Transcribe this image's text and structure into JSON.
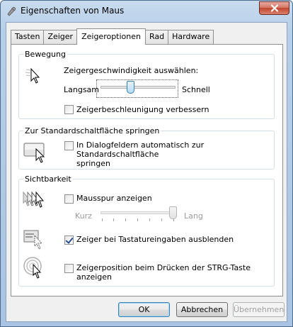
{
  "window": {
    "title": "Eigenschaften von Maus"
  },
  "tabs": [
    {
      "label": "Tasten"
    },
    {
      "label": "Zeiger"
    },
    {
      "label": "Zeigeroptionen"
    },
    {
      "label": "Rad"
    },
    {
      "label": "Hardware"
    }
  ],
  "motion": {
    "group_label": "Bewegung",
    "speed_label": "Zeigergeschwindigkeit auswählen:",
    "slow_label": "Langsam",
    "fast_label": "Schnell",
    "speed_level": 0.45,
    "precision_label": "Zeigerbeschleunigung verbessern",
    "precision_checked": false
  },
  "snap": {
    "group_label": "Zur Standardschaltfläche springen",
    "snap_label_line1": "In Dialogfeldern automatisch zur Standardschaltfläche",
    "snap_label_line2": "springen",
    "snap_checked": false
  },
  "visibility": {
    "group_label": "Sichtbarkeit",
    "trails_label": "Mausspur anzeigen",
    "trails_checked": false,
    "short_label": "Kurz",
    "long_label": "Lang",
    "trail_level": 1.0,
    "hide_label": "Zeiger bei Tastatureingaben ausblenden",
    "hide_checked": true,
    "ctrl_label": "Zeigerposition beim Drücken der STRG-Taste anzeigen",
    "ctrl_checked": false
  },
  "buttons": {
    "ok": "OK",
    "cancel": "Abbrechen",
    "apply": "Übernehmen"
  }
}
